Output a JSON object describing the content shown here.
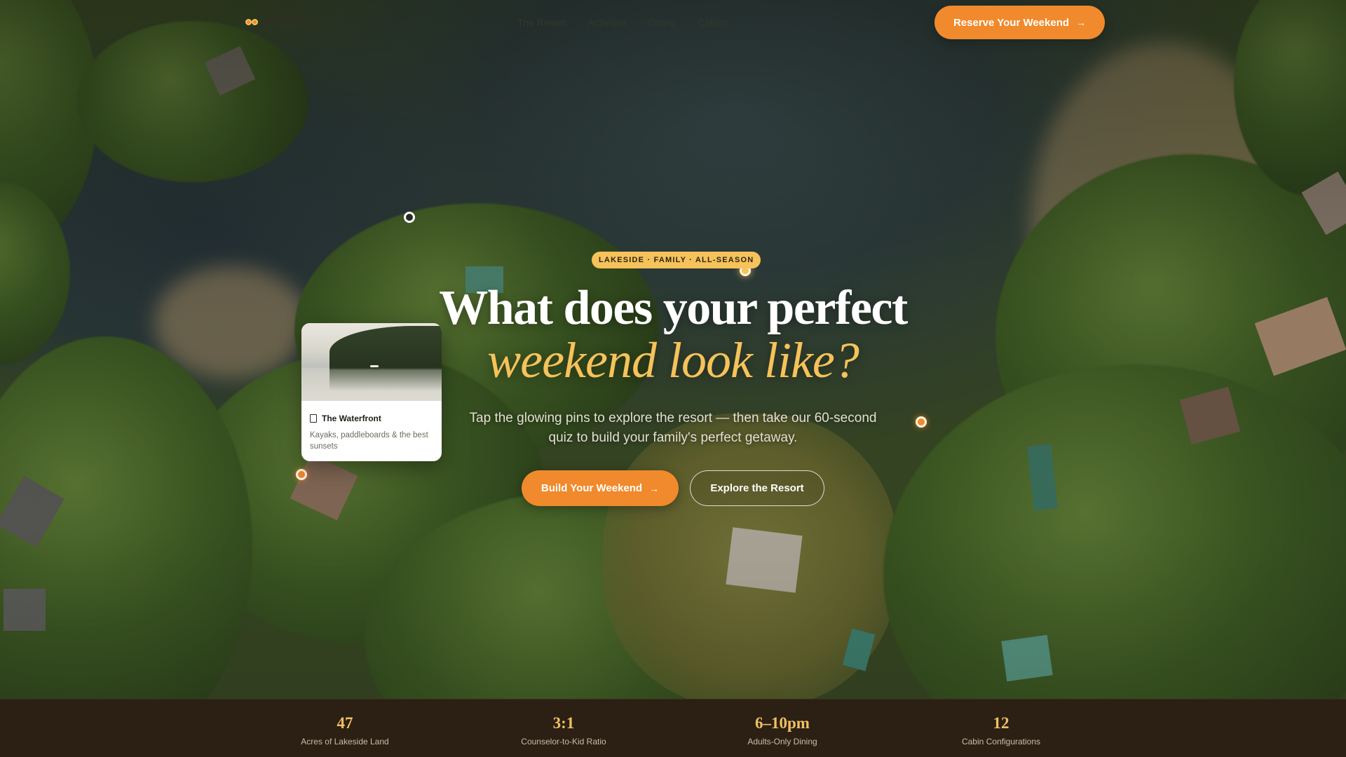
{
  "nav": {
    "brand": "Hearth",
    "links": [
      "The Resort",
      "Activities",
      "Dining",
      "Cabins"
    ],
    "cta": "Reserve Your Weekend"
  },
  "hero": {
    "eyebrow": "LAKESIDE · FAMILY · ALL-SEASON",
    "title_line1": "What does your perfect",
    "title_line2": "weekend look like?",
    "subtitle": "Tap the glowing pins to explore the resort — then take our 60-second quiz to build your family's perfect getaway.",
    "primary_button": "Build Your Weekend",
    "secondary_button": "Explore the Resort"
  },
  "card": {
    "title": "The Waterfront",
    "description": "Kayaks, paddleboards & the best sunsets"
  },
  "stats": [
    {
      "value": "47",
      "label": "Acres of Lakeside Land"
    },
    {
      "value": "3:1",
      "label": "Counselor-to-Kid Ratio"
    },
    {
      "value": "6–10pm",
      "label": "Adults-Only Dining"
    },
    {
      "value": "12",
      "label": "Cabin Configurations"
    }
  ],
  "colors": {
    "accent": "#f08a2c",
    "gold": "#f6c25a",
    "stats_bg": "#2b2013"
  },
  "icons": {
    "arrow": "→",
    "card_icon": "bookmark-icon",
    "brand_icon": "brand-logo-icon"
  }
}
